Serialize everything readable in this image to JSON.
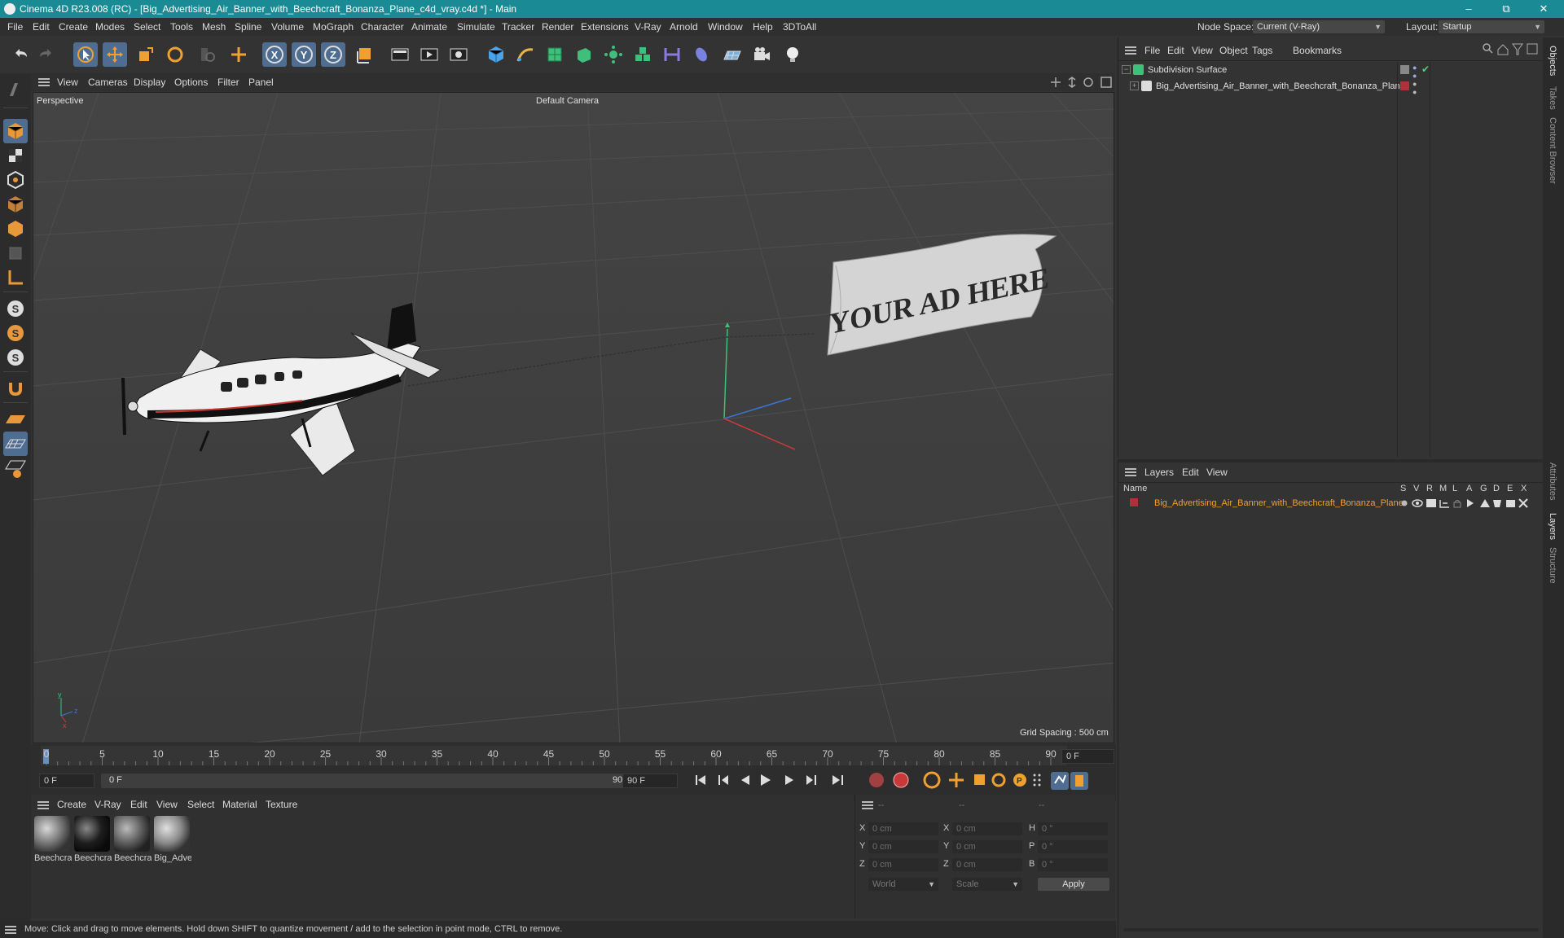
{
  "window": {
    "title": "Cinema 4D R23.008 (RC) - [Big_Advertising_Air_Banner_with_Beechcraft_Bonanza_Plane_c4d_vray.c4d *] - Main",
    "controls": [
      "–",
      "⧉",
      "✕"
    ]
  },
  "menubar": {
    "items": [
      "File",
      "Edit",
      "Create",
      "Modes",
      "Select",
      "Tools",
      "Mesh",
      "Spline",
      "Volume",
      "MoGraph",
      "Character",
      "Animate",
      "Simulate",
      "Tracker",
      "Render",
      "Extensions",
      "V-Ray",
      "Arnold",
      "Window",
      "Help",
      "3DToAll"
    ],
    "node_space_label": "Node Space:",
    "node_space_value": "Current (V-Ray)",
    "layout_label": "Layout:",
    "layout_value": "Startup"
  },
  "toolbar": {
    "icons": [
      "undo-icon",
      "redo-icon",
      "select-icon",
      "move-icon",
      "scale-icon",
      "rotate-icon",
      "recent-tools-icon",
      "transform-icon",
      "x-axis-icon",
      "y-axis-icon",
      "z-axis-icon",
      "coordinate-system-icon",
      "render-view-icon",
      "render-picture-viewer-icon",
      "render-settings-icon",
      "cube-icon",
      "pen-spline-icon",
      "subdivision-surface-icon",
      "extrude-icon",
      "array-icon",
      "mograph-cloner-icon",
      "deformer-icon",
      "field-icon",
      "floor-icon",
      "camera-icon",
      "light-icon"
    ]
  },
  "leftbar": {
    "icons": [
      "make-editable-icon",
      "model-mode-icon",
      "texture-mode-icon",
      "object-mode-icon",
      "points-mode-icon",
      "edges-mode-icon",
      "polygons-mode-icon",
      "axis-mode-icon",
      "solo-icon",
      "solo-hierarchy-icon",
      "solo-selection-icon",
      "snapping-icon",
      "workplane-icon",
      "grid-icon",
      "lock-workplane-icon"
    ]
  },
  "viewport": {
    "menu": [
      "View",
      "Cameras",
      "Display",
      "Options",
      "Filter",
      "Panel"
    ],
    "name": "Perspective",
    "camera": "Default Camera",
    "grid_spacing": "Grid Spacing : 500 cm",
    "banner_text": "YOUR AD HERE"
  },
  "timeline": {
    "ticks": [
      "0",
      "5",
      "10",
      "15",
      "20",
      "25",
      "30",
      "35",
      "40",
      "45",
      "50",
      "55",
      "60",
      "65",
      "70",
      "75",
      "80",
      "85",
      "90"
    ],
    "current_frame": "0 F",
    "start_field": "0 F",
    "range_start": "0 F",
    "range_end": "90 F",
    "end_field": "90 F"
  },
  "material_manager": {
    "menu": [
      "Create",
      "V-Ray",
      "Edit",
      "View",
      "Select",
      "Material",
      "Texture"
    ],
    "materials": [
      {
        "label": "Beechcra",
        "color": "#7a7a7a"
      },
      {
        "label": "Beechcra",
        "color": "#1e1e1e"
      },
      {
        "label": "Beechcra",
        "color": "#5e5e5e"
      },
      {
        "label": "Big_Adve",
        "color": "#8a8a8a"
      }
    ]
  },
  "coordinates": {
    "headers": [
      "--",
      "--",
      "--"
    ],
    "rows": [
      {
        "l1": "X",
        "v1": "0 cm",
        "l2": "X",
        "v2": "0 cm",
        "l3": "H",
        "v3": "0 °"
      },
      {
        "l1": "Y",
        "v1": "0 cm",
        "l2": "Y",
        "v2": "0 cm",
        "l3": "P",
        "v3": "0 °"
      },
      {
        "l1": "Z",
        "v1": "0 cm",
        "l2": "Z",
        "v2": "0 cm",
        "l3": "B",
        "v3": "0 °"
      }
    ],
    "space": "World",
    "mode": "Scale",
    "apply": "Apply"
  },
  "status": {
    "text": "Move: Click and drag to move elements. Hold down SHIFT to quantize movement / add to the selection in point mode, CTRL to remove."
  },
  "object_manager": {
    "menu": [
      "File",
      "Edit",
      "View",
      "Object",
      "Tags",
      "Bookmarks"
    ],
    "objects": [
      {
        "name": "Subdivision Surface"
      },
      {
        "name": "Big_Advertising_Air_Banner_with_Beechcraft_Bonanza_Plane"
      }
    ]
  },
  "layer_manager": {
    "menu": [
      "Layers",
      "Edit",
      "View"
    ],
    "name_header": "Name",
    "columns": [
      "S",
      "V",
      "R",
      "M",
      "L",
      "A",
      "G",
      "D",
      "E",
      "X"
    ],
    "layer_name": "Big_Advertising_Air_Banner_with_Beechcraft_Bonanza_Plane",
    "layer_color": "#b0303c"
  },
  "right_tabs": [
    "Objects",
    "Takes",
    "Content Browser",
    "Attributes",
    "Layers",
    "Structure"
  ]
}
